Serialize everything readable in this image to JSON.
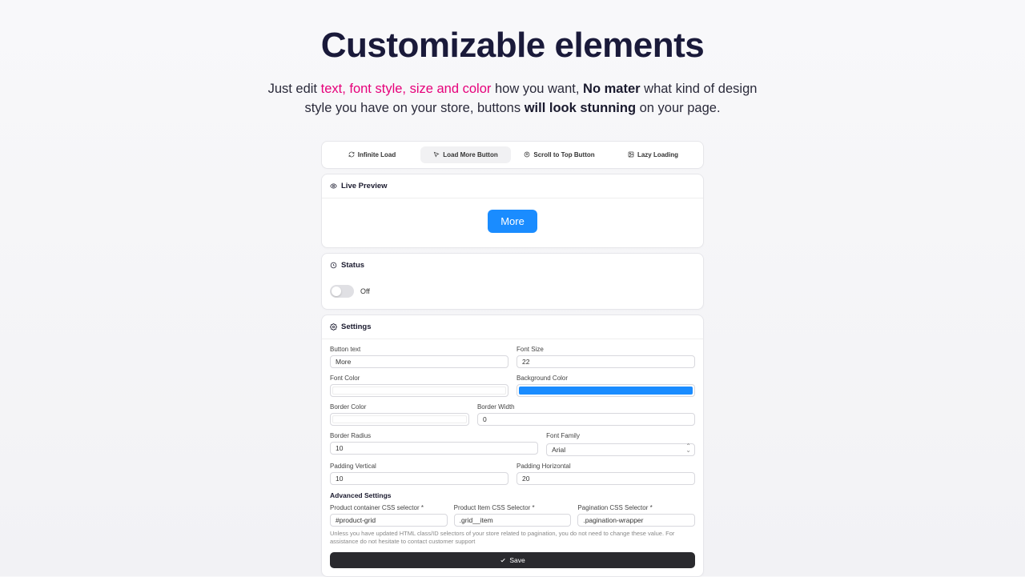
{
  "hero": {
    "title": "Customizable elements",
    "sub_pre": "Just edit ",
    "sub_accent": "text, font style, size and color",
    "sub_mid": " how you want, ",
    "sub_bold1": "No mater",
    "sub_mid2": " what kind of design style you have on your store, buttons ",
    "sub_bold2": "will look stunning",
    "sub_end": " on your page."
  },
  "tabs": {
    "t0": "Infinite Load",
    "t1": "Load More Button",
    "t2": "Scroll to Top Button",
    "t3": "Lazy Loading"
  },
  "preview": {
    "section": "Live Preview",
    "button": "More"
  },
  "status": {
    "section": "Status",
    "value": "Off"
  },
  "settings": {
    "section": "Settings",
    "button_text_label": "Button text",
    "button_text": "More",
    "font_size_label": "Font Size",
    "font_size": "22",
    "font_color_label": "Font Color",
    "bg_color_label": "Background Color",
    "border_color_label": "Border Color",
    "border_width_label": "Border Width",
    "border_width": "0",
    "border_radius_label": "Border Radius",
    "border_radius": "10",
    "font_family_label": "Font Family",
    "font_family": "Arial",
    "pad_v_label": "Padding Vertical",
    "pad_v": "10",
    "pad_h_label": "Padding Horizontal",
    "pad_h": "20",
    "adv_title": "Advanced Settings",
    "sel_container_label": "Product container CSS selector *",
    "sel_container": "#product-grid",
    "sel_item_label": "Product Item CSS Selector *",
    "sel_item": ".grid__item",
    "sel_pag_label": "Pagination CSS Selector *",
    "sel_pag": ".pagination-wrapper",
    "helper": "Unless you have updated HTML class/ID selectors of your store related to pagination, you do not need to change these value. For assistance do not hesitate to contact customer support",
    "save": "Save"
  },
  "colors": {
    "font_color": "#ffffff",
    "bg_color": "#1a8cff",
    "border_color": "#ffffff"
  }
}
